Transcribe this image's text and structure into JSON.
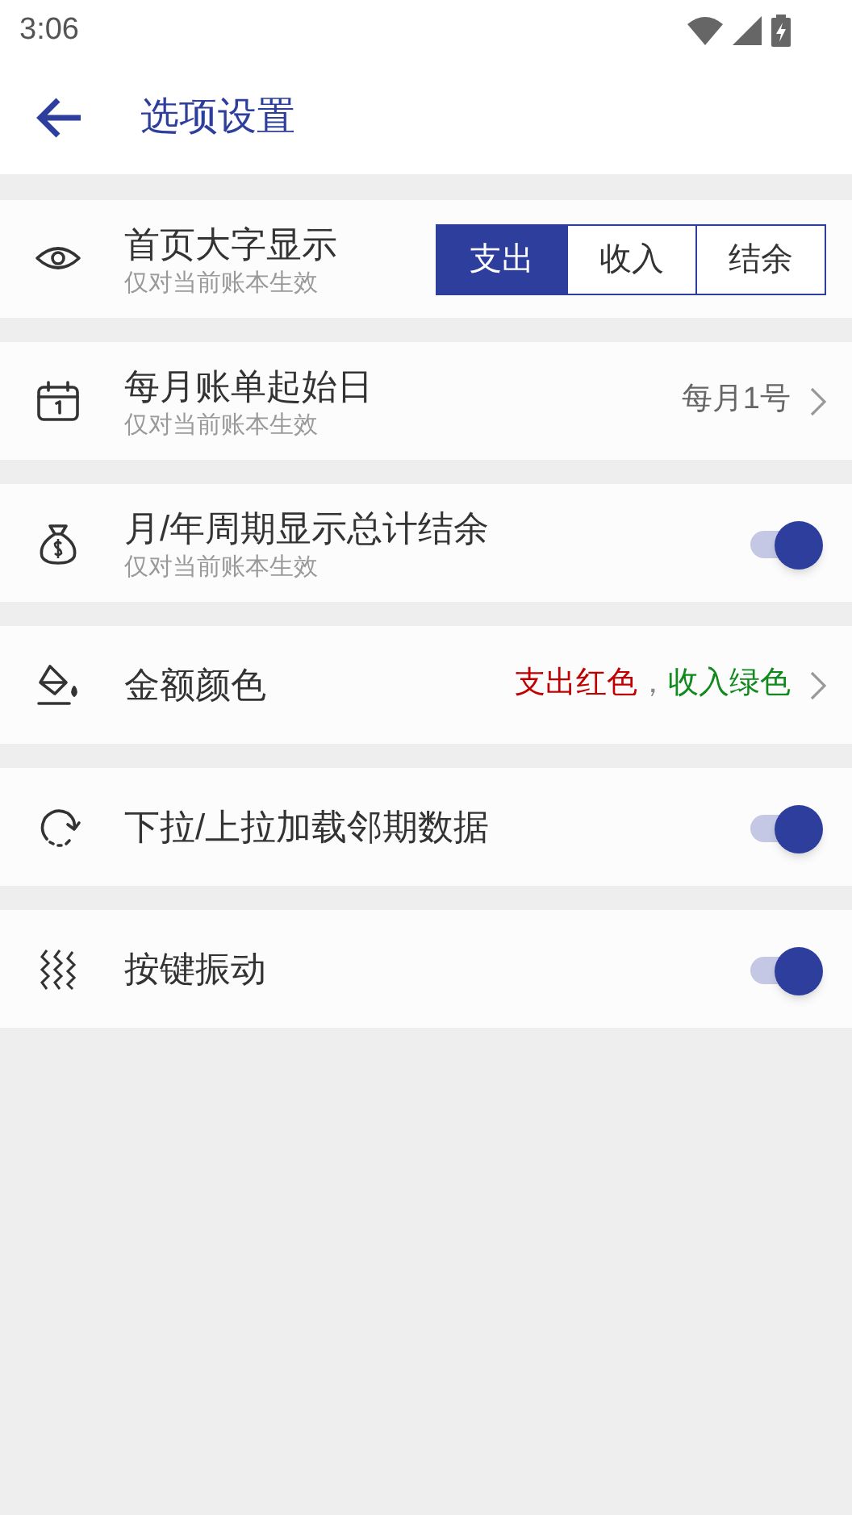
{
  "status_bar": {
    "time": "3:06"
  },
  "header": {
    "title": "选项设置"
  },
  "settings": [
    {
      "kind": "segmented",
      "title": "首页大字显示",
      "subtitle": "仅对当前账本生效",
      "options": [
        {
          "label": "支出",
          "selected": true
        },
        {
          "label": "收入",
          "selected": false
        },
        {
          "label": "结余",
          "selected": false
        }
      ]
    },
    {
      "kind": "value",
      "title": "每月账单起始日",
      "subtitle": "仅对当前账本生效",
      "value": "每月1号"
    },
    {
      "kind": "toggle",
      "title": "月/年周期显示总计结余",
      "subtitle": "仅对当前账本生效",
      "on": true
    },
    {
      "kind": "colors",
      "title": "金额颜色",
      "parts": [
        {
          "text": "支出红色",
          "color": "#c00000"
        },
        {
          "text": "，",
          "color": "#888888"
        },
        {
          "text": "收入绿色",
          "color": "#108a1c"
        }
      ]
    },
    {
      "kind": "toggle",
      "title": "下拉/上拉加载邻期数据",
      "on": true
    },
    {
      "kind": "toggle",
      "title": "按键振动",
      "on": true
    }
  ]
}
